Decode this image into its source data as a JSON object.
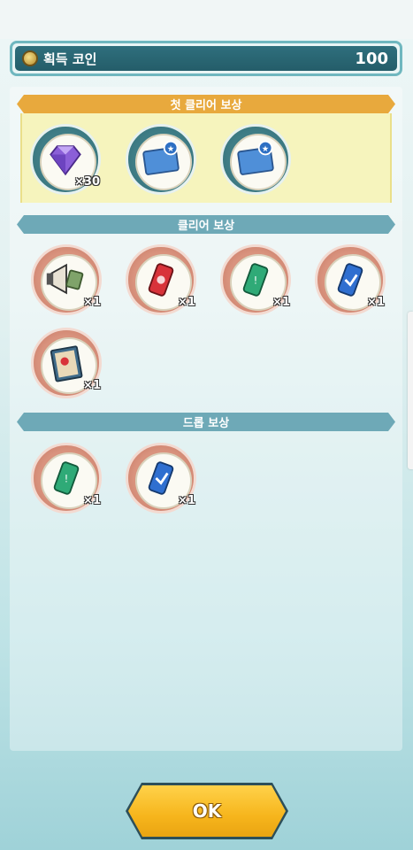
{
  "coin_bar": {
    "label": "획득 코인",
    "value": "100"
  },
  "sections": {
    "first_clear": {
      "title": "첫 클리어 보상"
    },
    "clear": {
      "title": "클리어 보상"
    },
    "drop": {
      "title": "드롭 보상"
    }
  },
  "first_clear_rewards": [
    {
      "icon": "purple-gem-icon",
      "qty": "×30"
    },
    {
      "icon": "star-map-icon",
      "qty": ""
    },
    {
      "icon": "star-map-icon",
      "qty": ""
    }
  ],
  "clear_rewards": [
    {
      "icon": "megaphone-ticket-icon",
      "qty": "×1"
    },
    {
      "icon": "red-can-icon",
      "qty": "×1"
    },
    {
      "icon": "green-can-icon",
      "qty": "×1"
    },
    {
      "icon": "blue-can-icon",
      "qty": "×1"
    },
    {
      "icon": "book-icon",
      "qty": "×1"
    }
  ],
  "drop_rewards": [
    {
      "icon": "green-can-icon",
      "qty": "×1"
    },
    {
      "icon": "blue-can-icon",
      "qty": "×1"
    }
  ],
  "ok_button": {
    "label": "OK"
  },
  "colors": {
    "first_header": "#e8a93d",
    "section_header": "#6ea9b7",
    "ok_button": "#f6b51c"
  }
}
